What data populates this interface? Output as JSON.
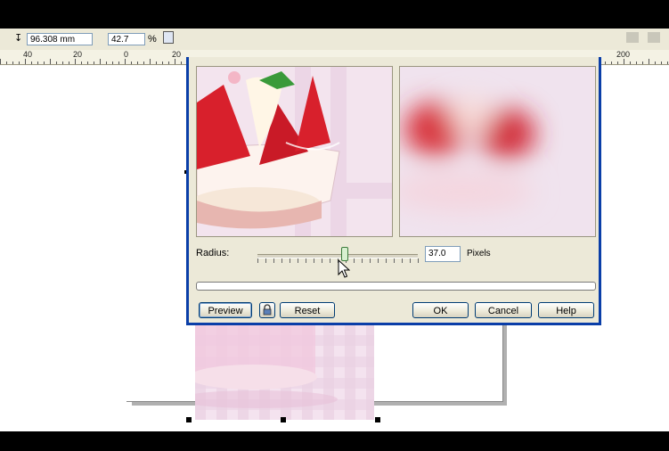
{
  "toolbar": {
    "height_value": "96.308 mm",
    "scale_value": "42.7",
    "percent_sign": "%"
  },
  "ruler": {
    "labels": [
      "40",
      "20",
      "0",
      "20",
      "200"
    ]
  },
  "dialog": {
    "radius_label": "Radius:",
    "radius_value": "37.0",
    "units_label": "Pixels",
    "buttons": {
      "preview": "Preview",
      "reset": "Reset",
      "ok": "OK",
      "cancel": "Cancel",
      "help": "Help"
    }
  },
  "icons": {
    "lock": "lock-icon",
    "cursor": "arrow-cursor-icon",
    "height": "height-icon"
  },
  "colors": {
    "dialog_frame": "#0a3ea8",
    "dialog_face": "#ece9d8",
    "strawberry": "#d8202c",
    "cream": "#f6e7d8",
    "pink_bg": "#f1d4e6"
  }
}
